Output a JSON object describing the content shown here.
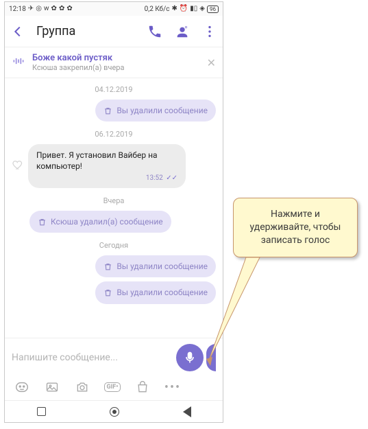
{
  "status": {
    "time": "12:18",
    "speed": "0,2 Кб/с",
    "battery": "96"
  },
  "header": {
    "title": "Группа"
  },
  "pinned": {
    "title": "Боже какой пустяк",
    "sub": "Ксюша закрепил(а) вчера"
  },
  "dates": {
    "d1": "04.12.2019",
    "d2": "06.12.2019",
    "d3": "Вчера",
    "d4": "Сегодня"
  },
  "msgs": {
    "deleted_you": "Вы удалили сообщение",
    "incoming": "Привет. Я установил Вайбер на компьютер!",
    "incoming_time": "13:52",
    "deleted_other": "Ксюша удалил(а) сообщение"
  },
  "input": {
    "placeholder": "Напишите сообщение..."
  },
  "tools": {
    "gif": "GIF•"
  },
  "callout": {
    "text": "Нажмите и удерживайте, чтобы записать голос"
  }
}
